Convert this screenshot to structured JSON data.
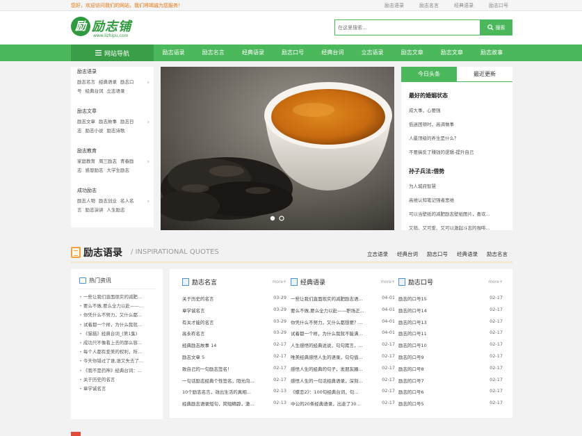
{
  "topbar": {
    "welcome": "您好，欢迎访问我们的网站，我们将竭诚为您服务！",
    "links": [
      "励志语录",
      "励志名言",
      "经典语录",
      "励志口号"
    ]
  },
  "header": {
    "logo_badge": "励",
    "logo_name": "励志铺",
    "logo_url": "www.lizhipu.com",
    "search_placeholder": "在这里搜索...",
    "search_button": "搜索"
  },
  "nav": {
    "home": "网站导航",
    "items": [
      "励志语录",
      "励志名言",
      "经典语录",
      "励志口号",
      "经典台词",
      "立志语录",
      "励志文章",
      "励志文章",
      "励志故事"
    ]
  },
  "catmenu": [
    {
      "title": "励志语录",
      "links": [
        "励志名言",
        "经典语录",
        "励志口号",
        "经典台词",
        "立志语录"
      ]
    },
    {
      "title": "励志文章",
      "links": [
        "励志文章",
        "励志故事",
        "励志日志",
        "励志小说",
        "励志诗歌"
      ]
    },
    {
      "title": "励志教育",
      "links": [
        "家庭教育",
        "周三励志",
        "青春励志",
        "感恩励志",
        "大学生励志"
      ]
    },
    {
      "title": "成功励志",
      "links": [
        "励志人物",
        "励志创业",
        "名人名言",
        "励志演讲",
        "人生励志"
      ]
    }
  ],
  "news": {
    "tabs": [
      "今日头条",
      "最近更新"
    ],
    "groups": [
      {
        "title": "最好的婚姻状态",
        "items": [
          "成大事，心要强",
          "低迷困顿时，高调做事",
          "人最顶级的养生是什么？",
          "不要搞反了赚钱的逻辑-提升自己"
        ]
      },
      {
        "title": "孙子兵法:借势",
        "items": [
          "为人城府智慧",
          "高维认知笔记强者思维",
          "可以当壁纸的减肥励志壁纸图片，喜欢...",
          "又萌、又可爱、又可以激起斗志的咖啡..."
        ]
      }
    ]
  },
  "section": {
    "title": "励志语录",
    "subtitle": "/ INSPIRATIONAL QUOTES",
    "links": [
      "立志语录",
      "经典台词",
      "励志口号",
      "经典语录",
      "励志名言"
    ]
  },
  "hot": {
    "title": "热门资讯",
    "items": [
      "一些让我们直面现实的减肥...",
      "要么不做,要么全力以赴——...",
      "你凭什么不努力，又什么都...",
      "试着都一个样，为什么我就...",
      "《猫猫》经典台词_(第1集)",
      "成功只不像看上去的那么容...",
      "每个人都有爱美的权利，所...",
      "今天你错过了谁,谁又失去了...",
      "《我不是药神》经典台词：...",
      "关于历史的名言",
      "章学诚名言"
    ]
  },
  "lists": [
    {
      "name": "励志名言",
      "more": "more+",
      "rows": [
        {
          "t": "关于历史的名言",
          "d": "03-29"
        },
        {
          "t": "章学诚名言",
          "d": "03-29"
        },
        {
          "t": "有关才能的名言",
          "d": "03-29"
        },
        {
          "t": "高永祚名言",
          "d": "03-29"
        },
        {
          "t": "经典励志故事 14",
          "d": "02-17"
        },
        {
          "t": "励志文章 5",
          "d": "02-17"
        },
        {
          "t": "致自己的一句励志签名！",
          "d": "02-17"
        },
        {
          "t": "一句话励志经典个性签名，阳光向...",
          "d": "02-17"
        },
        {
          "t": "10个励志名言，效出生活的真相...",
          "d": "02-13"
        },
        {
          "t": "经典励志语录短句，简短精辟，激...",
          "d": "02-13"
        }
      ]
    },
    {
      "name": "经典语录",
      "more": "more+",
      "rows": [
        {
          "t": "一些让我们直面现实的减肥励志语...",
          "d": "04-01"
        },
        {
          "t": "要么不做,要么全力以赴——职场正...",
          "d": "04-01"
        },
        {
          "t": "你凭什么不努力，又什么都想要？...",
          "d": "04-01"
        },
        {
          "t": "试着都一个样，为什么我就不能满...",
          "d": "04-01"
        },
        {
          "t": "人生感悟的经典说说，句句箴言，...",
          "d": "02-17"
        },
        {
          "t": "唯美经典感悟人生的语录，句句值...",
          "d": "02-17"
        },
        {
          "t": "感悟人生的经典的句子，发朋友圈...",
          "d": "02-17"
        },
        {
          "t": "感悟人生的一句话经典语录，深刻...",
          "d": "02-17"
        },
        {
          "t": "《蝶恋2》：100句经典台词，句...",
          "d": "02-17"
        },
        {
          "t": "中公的20条经典语录，出走了30...",
          "d": "02-17"
        }
      ]
    },
    {
      "name": "励志口号",
      "more": "more+",
      "rows": [
        {
          "t": "励志的口号15",
          "d": "02-17"
        },
        {
          "t": "励志的口号14",
          "d": "02-17"
        },
        {
          "t": "励志的口号13",
          "d": "02-17"
        },
        {
          "t": "励志的口号11",
          "d": "02-17"
        },
        {
          "t": "励志的口号10",
          "d": "02-17"
        },
        {
          "t": "励志的口号9",
          "d": "02-17"
        },
        {
          "t": "励志的口号8",
          "d": "02-17"
        },
        {
          "t": "励志的口号7",
          "d": "02-17"
        },
        {
          "t": "励志的口号6",
          "d": "02-17"
        },
        {
          "t": "励志的口号5",
          "d": "02-17"
        }
      ]
    }
  ],
  "colors": {
    "brand_green": "#4cb85c",
    "nav_dark_green": "#3a9e48",
    "accent_orange": "#f2a33a",
    "icon_blue": "#4a90d9"
  },
  "icons": {
    "nav_home": "list-icon",
    "search": "search-icon",
    "section": "book-icon",
    "hot": "news-icon",
    "list_header": "document-icon"
  }
}
